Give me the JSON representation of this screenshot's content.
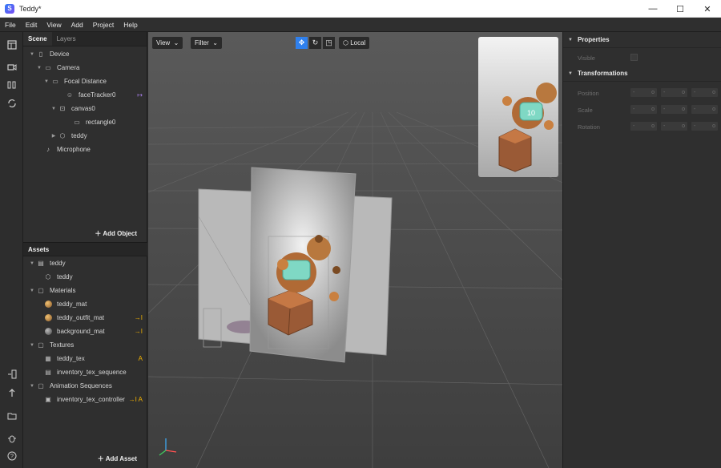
{
  "window": {
    "title": "Teddy*",
    "app_icon": "S",
    "minimize": "—",
    "maximize": "☐",
    "close": "✕"
  },
  "menu": [
    "File",
    "Edit",
    "View",
    "Add",
    "Project",
    "Help"
  ],
  "tools": [
    "layout-icon",
    "video-icon",
    "columns-icon",
    "sync-icon",
    "device-icon",
    "upload-icon",
    "folder-icon",
    "bug-icon",
    "help-icon"
  ],
  "scene": {
    "tabs": [
      "Scene",
      "Layers"
    ],
    "items": [
      {
        "label": "Device",
        "icon": "phone-icon",
        "arrow": "▼"
      },
      {
        "label": "Camera",
        "icon": "camera-icon",
        "arrow": "▼"
      },
      {
        "label": "Focal Distance",
        "icon": "focal-icon",
        "arrow": "▼"
      },
      {
        "label": "faceTracker0",
        "icon": "face-tracker-icon",
        "arrow": "",
        "badge": "↦"
      },
      {
        "label": "canvas0",
        "icon": "canvas-icon",
        "arrow": "▼"
      },
      {
        "label": "rectangle0",
        "icon": "rectangle-icon",
        "arrow": ""
      },
      {
        "label": "teddy",
        "icon": "cube-icon",
        "arrow": "▶"
      },
      {
        "label": "Microphone",
        "icon": "microphone-icon",
        "arrow": ""
      }
    ],
    "add_label": "Add Object"
  },
  "assets": {
    "title": "Assets",
    "items": [
      {
        "label": "teddy",
        "icon": "file-icon",
        "arrow": "▼"
      },
      {
        "label": "teddy",
        "icon": "cube-icon",
        "arrow": ""
      },
      {
        "label": "Materials",
        "icon": "folder-icon",
        "arrow": "▼"
      },
      {
        "label": "teddy_mat",
        "icon": "material-icon",
        "arrow": ""
      },
      {
        "label": "teddy_outfit_mat",
        "icon": "material-icon",
        "arrow": "",
        "badge": "→I"
      },
      {
        "label": "background_mat",
        "icon": "material-icon",
        "arrow": "",
        "badge": "→I"
      },
      {
        "label": "Textures",
        "icon": "folder-icon",
        "arrow": "▼"
      },
      {
        "label": "teddy_tex",
        "icon": "texture-icon",
        "arrow": "",
        "badge": "A"
      },
      {
        "label": "inventory_tex_sequence",
        "icon": "sequence-icon",
        "arrow": ""
      },
      {
        "label": "Animation Sequences",
        "icon": "folder-icon",
        "arrow": "▼"
      },
      {
        "label": "inventory_tex_controller",
        "icon": "controller-icon",
        "arrow": "",
        "badge": "→I A"
      }
    ],
    "add_label": "Add Asset"
  },
  "viewport": {
    "view_label": "View",
    "filter_label": "Filter",
    "local_label": "Local",
    "jersey_number": "10"
  },
  "properties": {
    "title": "Properties",
    "visible_label": "Visible",
    "transformations_title": "Transformations",
    "rows": [
      "Position",
      "Scale",
      "Rotation"
    ],
    "field_value": "-",
    "field_unit": "o"
  }
}
